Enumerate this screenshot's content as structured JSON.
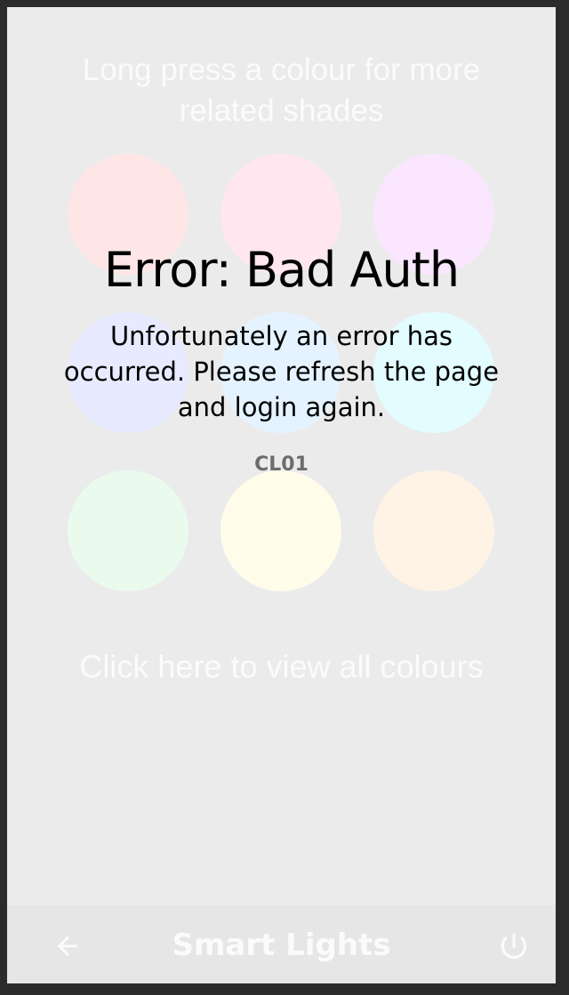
{
  "hint": {
    "line1": "Long press a colour for more",
    "line2": "related shades"
  },
  "swatches": [
    {
      "name": "swatch-pink-light",
      "color": "#ffe6e6"
    },
    {
      "name": "swatch-rose-light",
      "color": "#ffe6ef"
    },
    {
      "name": "swatch-lavender-light",
      "color": "#fae6ff"
    },
    {
      "name": "swatch-periwinkle-light",
      "color": "#e8ebff"
    },
    {
      "name": "swatch-sky-light",
      "color": "#e4f3ff"
    },
    {
      "name": "swatch-cyan-light",
      "color": "#e2fcff"
    },
    {
      "name": "swatch-mint-light",
      "color": "#eafbee"
    },
    {
      "name": "swatch-cream-light",
      "color": "#fffdea"
    },
    {
      "name": "swatch-peach-light",
      "color": "#fff3e6"
    }
  ],
  "all_colours_link": "Click here to view all colours",
  "error": {
    "title": "Error: Bad Auth",
    "message": "Unfortunately an error has occurred. Please refresh the page and login again.",
    "code": "CL01"
  },
  "bottom_bar": {
    "title": "Smart Lights",
    "back_icon": "arrow-left-icon",
    "power_icon": "power-icon",
    "icon_color": "#fbfbfb"
  }
}
